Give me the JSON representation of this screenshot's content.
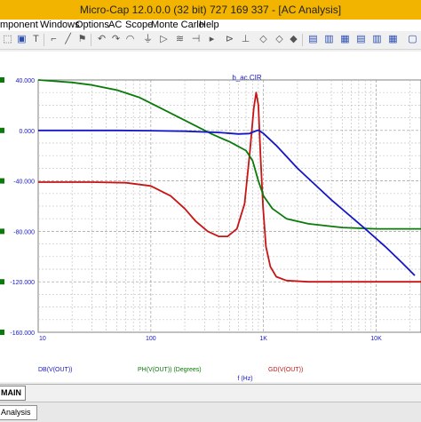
{
  "window": {
    "title": "Micro-Cap 12.0.0.0 (32 bit) 727 169 337 - [AC Analysis]"
  },
  "menu": {
    "items": [
      "mponent",
      "Windows",
      "Options",
      "AC",
      "Scope",
      "Monte Carlo",
      "Help"
    ]
  },
  "toolbar": {
    "icons": [
      "arrow-icon",
      "image-icon",
      "text-icon",
      "wire-icon",
      "diagonal-wire-icon",
      "flag-icon",
      "undo-arc-icon",
      "redo-arc-icon",
      "arc-icon",
      "ground-icon",
      "gate-icon",
      "resistor-icon",
      "capacitor-icon",
      "diode-icon",
      "npn-icon",
      "scale-icon",
      "cursor-icon",
      "plot-icon",
      "grid-icon",
      "table-icon",
      "tile-icon",
      "cascade-icon",
      "maximize-icon"
    ]
  },
  "plot": {
    "title": "b_ac.CIR",
    "x_axis_label": "f (Hz)",
    "legend": [
      {
        "text": "DB(V(OUT))",
        "color": "#1515c8"
      },
      {
        "text": "PH(V(OUT)) (Degrees)",
        "color": "#0a7a0a"
      },
      {
        "text": "GD(V(OUT))",
        "color": "#c81414"
      }
    ]
  },
  "chart_data": {
    "type": "line",
    "title": "b_ac.CIR",
    "xlabel": "f (Hz)",
    "x_scale": "log",
    "xlim": [
      10,
      25000
    ],
    "x_ticks": [
      "10",
      "100",
      "1K",
      "10K"
    ],
    "ylim": [
      -160,
      40
    ],
    "y_ticks": [
      "40.000",
      "0.000",
      "-40.000",
      "-80.000",
      "-120.000",
      "-160.000"
    ],
    "grid": true,
    "legend_position": "bottom",
    "series": [
      {
        "name": "DB(V(OUT))",
        "color": "#1515c8",
        "points": [
          [
            10,
            0
          ],
          [
            50,
            0
          ],
          [
            100,
            -0.2
          ],
          [
            200,
            -0.6
          ],
          [
            400,
            -1.6
          ],
          [
            600,
            -2.8
          ],
          [
            750,
            -2.5
          ],
          [
            850,
            -0.5
          ],
          [
            900,
            0.2
          ],
          [
            1000,
            -2.5
          ],
          [
            1300,
            -12
          ],
          [
            2000,
            -30
          ],
          [
            4000,
            -55
          ],
          [
            8000,
            -78
          ],
          [
            12000,
            -92
          ],
          [
            17000,
            -105
          ],
          [
            22000,
            -115
          ]
        ]
      },
      {
        "name": "PH(V(OUT)) (Degrees)",
        "color": "#0a7a0a",
        "points": [
          [
            10,
            40
          ],
          [
            20,
            38
          ],
          [
            30,
            36
          ],
          [
            50,
            32
          ],
          [
            80,
            26
          ],
          [
            120,
            18
          ],
          [
            200,
            8
          ],
          [
            350,
            -3
          ],
          [
            500,
            -9
          ],
          [
            700,
            -16
          ],
          [
            800,
            -24
          ],
          [
            900,
            -40
          ],
          [
            1000,
            -52
          ],
          [
            1200,
            -62
          ],
          [
            1600,
            -70
          ],
          [
            2500,
            -74
          ],
          [
            5000,
            -77
          ],
          [
            10000,
            -78
          ],
          [
            25000,
            -78
          ]
        ]
      },
      {
        "name": "GD(V(OUT))",
        "color": "#c81414",
        "points": [
          [
            10,
            -41
          ],
          [
            30,
            -41
          ],
          [
            60,
            -41.5
          ],
          [
            100,
            -44
          ],
          [
            150,
            -52
          ],
          [
            200,
            -62
          ],
          [
            250,
            -72
          ],
          [
            320,
            -80
          ],
          [
            400,
            -84
          ],
          [
            480,
            -84
          ],
          [
            580,
            -78
          ],
          [
            680,
            -58
          ],
          [
            760,
            -15
          ],
          [
            820,
            18
          ],
          [
            860,
            30
          ],
          [
            900,
            20
          ],
          [
            940,
            -20
          ],
          [
            990,
            -60
          ],
          [
            1050,
            -92
          ],
          [
            1150,
            -108
          ],
          [
            1300,
            -116
          ],
          [
            1600,
            -119
          ],
          [
            2500,
            -120
          ],
          [
            5000,
            -120
          ],
          [
            25000,
            -120
          ]
        ]
      }
    ]
  },
  "bottom_tabs": {
    "tab1": "MAIN",
    "tab2": "Analysis"
  }
}
